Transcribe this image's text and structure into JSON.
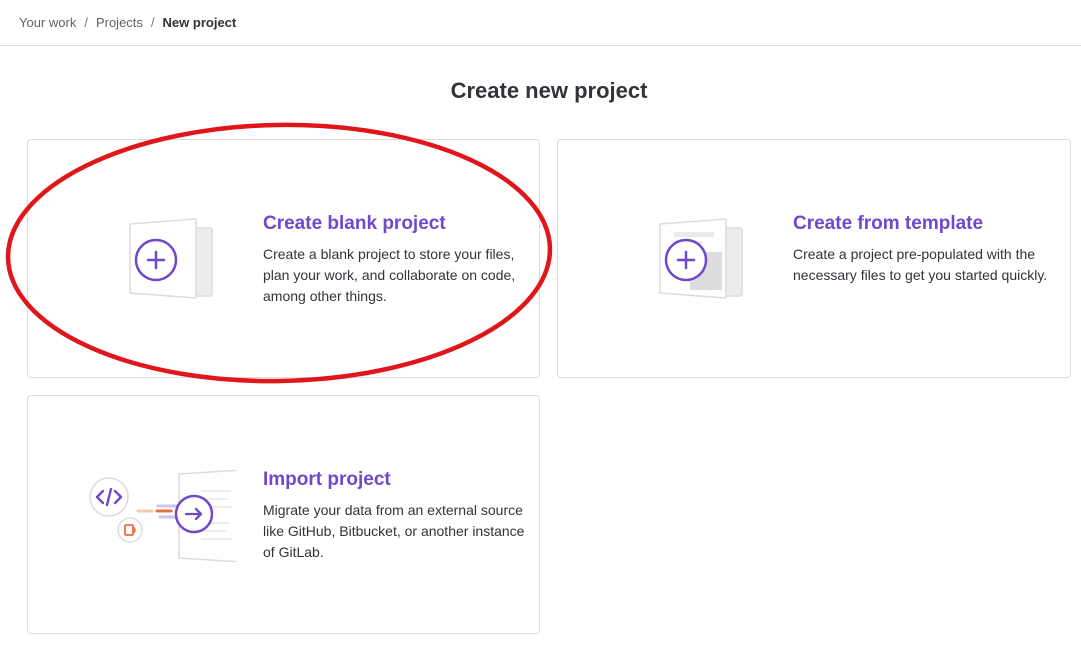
{
  "breadcrumb": {
    "items": [
      {
        "label": "Your work"
      },
      {
        "label": "Projects"
      },
      {
        "label": "New project"
      }
    ],
    "separator": "/"
  },
  "page": {
    "title": "Create new project"
  },
  "cards": [
    {
      "id": "blank",
      "title": "Create blank project",
      "description": "Create a blank project to store your files, plan your work, and collaborate on code, among other things.",
      "icon": "plus-icon"
    },
    {
      "id": "template",
      "title": "Create from template",
      "description": "Create a project pre-populated with the necessary files to get you started quickly.",
      "icon": "plus-icon"
    },
    {
      "id": "import",
      "title": "Import project",
      "description": "Migrate your data from an external source like GitHub, Bitbucket, or another instance of GitLab.",
      "icon": "arrow-right-icon"
    }
  ],
  "colors": {
    "accent": "#6e49cb",
    "border": "#dcdcde",
    "annotation": "#e0161c",
    "import_orange": "#e9703e"
  }
}
